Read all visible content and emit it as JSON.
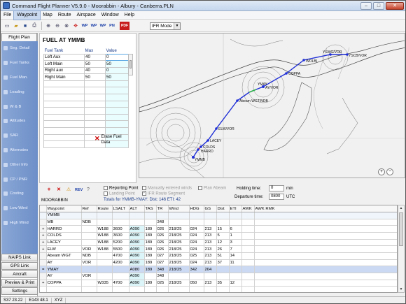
{
  "window": {
    "title": "Command Flight Planner V5.9.0 - Moorabbin - Albury - Canberra.PLN"
  },
  "menu": [
    "File",
    "Waypoint",
    "Map",
    "Route",
    "Airspace",
    "Window",
    "Help"
  ],
  "toolbar": {
    "icons": [
      "new-file-icon",
      "open-folder-icon",
      "save-icon",
      "print-icon",
      "zoom-in-icon",
      "zoom-out-icon",
      "zoom-extent-icon",
      "route-direct-icon",
      "insert-waypoint-icon",
      "append-waypoint-icon",
      "delete-waypoint-icon",
      "edit-waypoint-icon",
      "pdf-export-icon"
    ],
    "glyphs": [
      "▭",
      "▰",
      "■",
      "⎙",
      "⊕",
      "⊖",
      "⊗",
      "✥",
      "WP",
      "WP",
      "WP",
      "PN",
      "PDF"
    ],
    "mode_select": "IFR Mode"
  },
  "leftnav": {
    "header": "Flight Plan",
    "items": [
      "Seg. Detail",
      "Fuel Tanks",
      "Fuel Man.",
      "Loading",
      "W & B",
      "Altitudes",
      "SAR",
      "Alternates",
      "Other Info",
      "CP / PNR",
      "Costing",
      "Low Wind",
      "High Wind"
    ],
    "bottom": [
      "NAIPS Link",
      "GPS Link",
      "Aircraft",
      "Preview & Print",
      "Settings"
    ]
  },
  "fuel": {
    "title": "FUEL AT YMMB",
    "columns": [
      "Fuel Tank",
      "Max",
      "Value"
    ],
    "rows": [
      [
        "Left Aux",
        "40",
        "0"
      ],
      [
        "Left Main",
        "50",
        "50"
      ],
      [
        "Right aux",
        "40",
        "0"
      ],
      [
        "Right Main",
        "50",
        "50"
      ],
      [
        "",
        "",
        ""
      ],
      [
        "",
        "",
        ""
      ],
      [
        "",
        "",
        ""
      ],
      [
        "",
        "",
        ""
      ],
      [
        "",
        "",
        ""
      ],
      [
        "",
        "",
        ""
      ],
      [
        "",
        "",
        ""
      ],
      [
        "",
        "",
        ""
      ],
      [
        "",
        "",
        ""
      ],
      [
        "",
        "",
        ""
      ]
    ],
    "erase_label": "Erase Fuel Data"
  },
  "map": {
    "labels": [
      "YMMB",
      "HARRD",
      "COLDS",
      "LACEY",
      "ELW/VOR",
      "AY/VOR",
      "Abeam WGT/NDB",
      "YMAY",
      "COPPA",
      "WOLBI",
      "YSWG/VOR",
      "YSCB/VOR"
    ],
    "zoom_in": "+",
    "zoom_out": "−"
  },
  "lower": {
    "reporting_point": "Reporting Point",
    "landing_point": "Landing Point",
    "manually_entered": "Manually entered winds",
    "ifr_route_segment": "IFR Route Segment",
    "plan_abeam": "Plan Abeam",
    "holding_label": "Holding time:",
    "holding_value": "0",
    "holding_unit": "min",
    "departure_label": "Departure time:",
    "departure_value": "0800",
    "departure_unit": "UTC",
    "origin": "MOORABBIN",
    "totals": "Totals for YMMB-YMAY:  Dist: 146  ETI: 42"
  },
  "route": {
    "columns": [
      "",
      "Waypoint",
      "Ref",
      "Route",
      "LSALT",
      "ALT",
      "TAS",
      "TR",
      "Wind",
      "HDG",
      "GS",
      "Dist",
      "ETI",
      "AWK",
      "AWK RMK"
    ],
    "rows": [
      [
        "",
        "YMMB",
        "",
        "",
        "",
        "",
        "",
        "",
        "",
        "",
        "",
        "",
        "",
        "",
        ""
      ],
      [
        "",
        "MB",
        "NDB",
        "",
        "",
        "",
        "",
        "348",
        "",
        "",
        "",
        "",
        "",
        "",
        ""
      ],
      [
        "+",
        "HARRD",
        "",
        "W188",
        "3600",
        "A090",
        "189",
        "026",
        "218/25",
        "024",
        "213",
        "15",
        "6",
        "",
        ""
      ],
      [
        "+",
        "COLDS",
        "",
        "W188",
        "3600",
        "A090",
        "189",
        "026",
        "218/25",
        "024",
        "213",
        "5",
        "1",
        "",
        ""
      ],
      [
        "+",
        "LACEY",
        "",
        "W188",
        "5200",
        "A090",
        "189",
        "026",
        "218/25",
        "024",
        "213",
        "12",
        "3",
        "",
        ""
      ],
      [
        "+",
        "ELW",
        "VOR",
        "W188",
        "5500",
        "A090",
        "189",
        "026",
        "218/25",
        "024",
        "213",
        "26",
        "7",
        "",
        ""
      ],
      [
        "",
        "Abeam WGT",
        "NDB",
        "",
        "4700",
        "A090",
        "189",
        "027",
        "218/25",
        "025",
        "213",
        "51",
        "14",
        "",
        ""
      ],
      [
        "",
        "AY",
        "VOR",
        "",
        "4200",
        "A090",
        "189",
        "027",
        "218/25",
        "024",
        "213",
        "37",
        "11",
        "",
        ""
      ],
      [
        "=",
        "YMAY",
        "",
        "",
        "",
        "A080",
        "189",
        "348",
        "218/25",
        "342",
        "204",
        "",
        "",
        "",
        ""
      ],
      [
        "",
        "AY",
        "VOR",
        "",
        "",
        "A090",
        "",
        "348",
        "",
        "",
        "",
        "",
        "",
        "",
        ""
      ],
      [
        "+",
        "COPPA",
        "",
        "W335",
        "4700",
        "A090",
        "189",
        "025",
        "218/25",
        "050",
        "213",
        "35",
        "12",
        "",
        ""
      ]
    ]
  },
  "status": [
    "S37 23.22",
    "E143 48.1",
    "XYZ"
  ],
  "colors": {
    "route_line": "#1f2fd6",
    "nav_bg": "#7c9bd0",
    "selected_row": "#cbd9f2",
    "value_cell": "#e9fcfe"
  }
}
